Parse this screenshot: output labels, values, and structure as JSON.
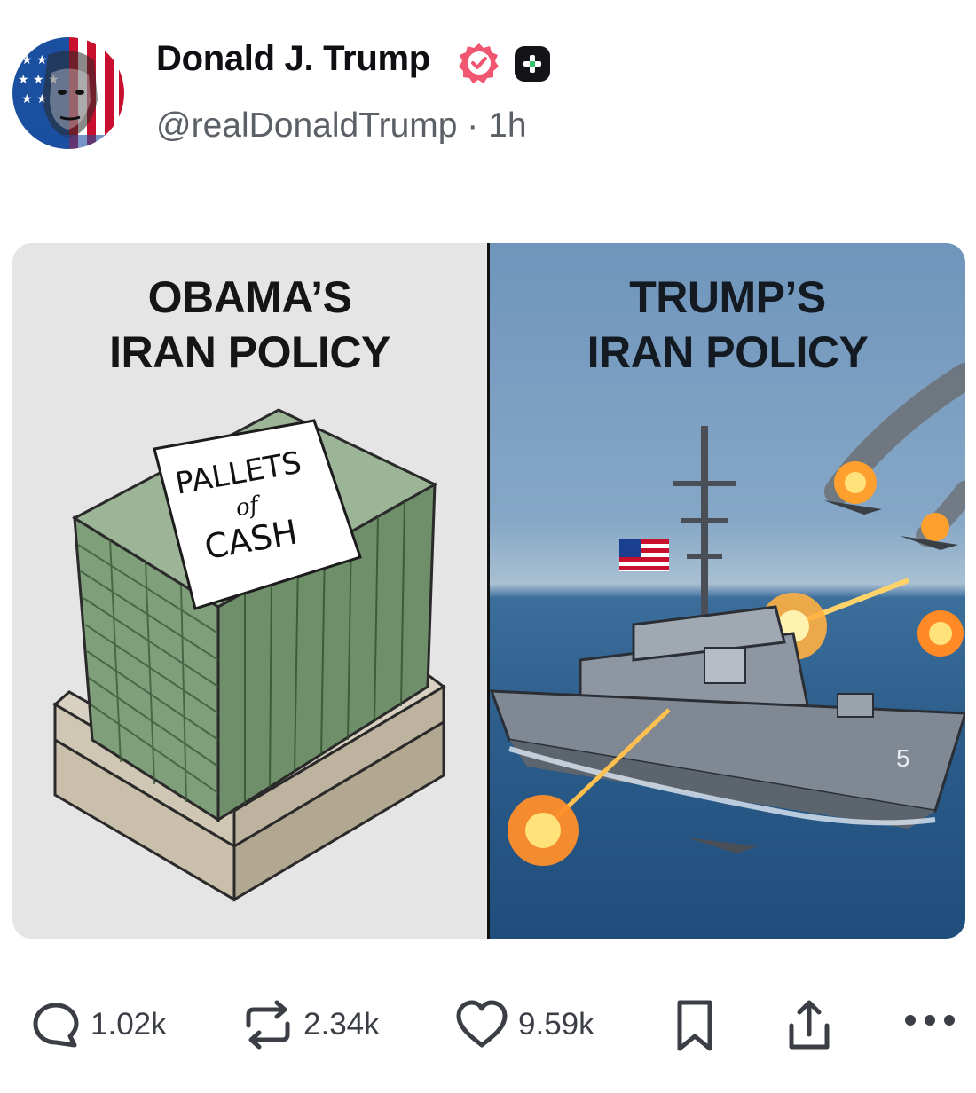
{
  "post": {
    "author_name": "Donald J. Trump",
    "handle": "@realDonaldTrump",
    "separator": "·",
    "time_ago": "1h"
  },
  "media": {
    "left_caption_line1": "OBAMA’S",
    "left_caption_line2": "IRAN POLICY",
    "sign_line1": "PALLETS",
    "sign_line2": "of",
    "sign_line3": "CASH",
    "right_caption_line1": "TRUMP’S",
    "right_caption_line2": "IRAN POLICY",
    "ship_hull_number": "5"
  },
  "actions": {
    "replies": "1.02k",
    "reposts": "2.34k",
    "likes": "9.59k"
  },
  "colors": {
    "verified_badge": "#f0566f",
    "icon_gray": "#3b3f45",
    "cash_green": "#7f9f7a",
    "sea_blue": "#2c5d8b"
  },
  "icons": [
    "reply-icon",
    "repost-icon",
    "heart-icon",
    "bookmark-icon",
    "share-icon",
    "more-icon",
    "verified-icon",
    "plus-badge-icon"
  ]
}
